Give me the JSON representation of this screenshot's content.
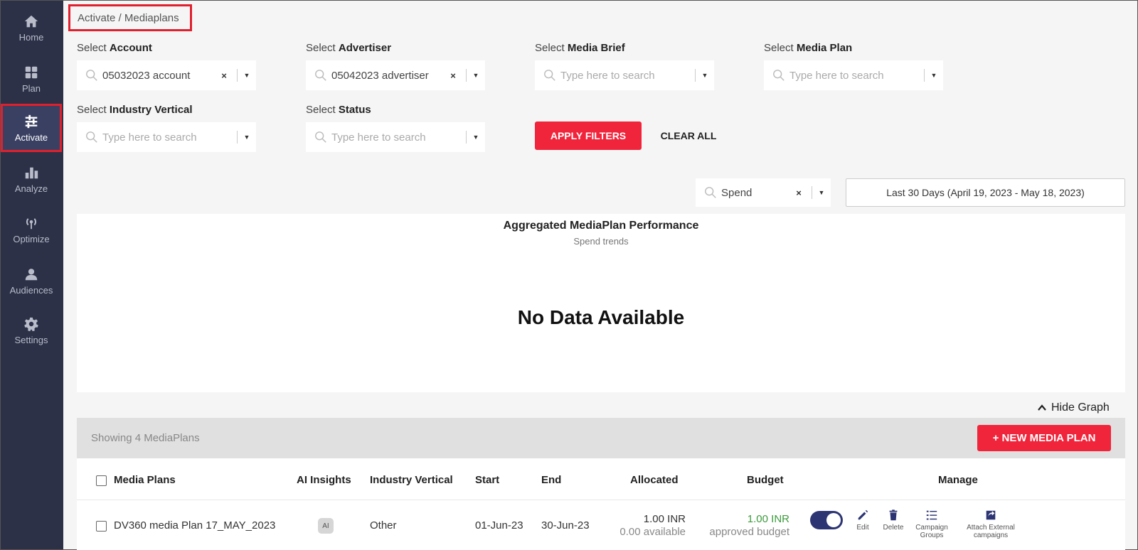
{
  "sidebar": {
    "items": [
      {
        "label": "Home",
        "icon": "home-icon"
      },
      {
        "label": "Plan",
        "icon": "grid-icon"
      },
      {
        "label": "Activate",
        "icon": "sliders-icon",
        "active": true
      },
      {
        "label": "Analyze",
        "icon": "bar-chart-icon"
      },
      {
        "label": "Optimize",
        "icon": "broadcast-icon"
      },
      {
        "label": "Audiences",
        "icon": "person-icon"
      },
      {
        "label": "Settings",
        "icon": "gear-icon"
      }
    ]
  },
  "breadcrumb": "Activate / Mediaplans",
  "filters": {
    "account": {
      "label_prefix": "Select ",
      "label_bold": "Account",
      "value": "05032023 account"
    },
    "advertiser": {
      "label_prefix": "Select ",
      "label_bold": "Advertiser",
      "value": "05042023 advertiser"
    },
    "media_brief": {
      "label_prefix": "Select ",
      "label_bold": "Media Brief",
      "placeholder": "Type here to search"
    },
    "media_plan": {
      "label_prefix": "Select ",
      "label_bold": "Media Plan",
      "placeholder": "Type here to search"
    },
    "industry_vertical": {
      "label_prefix": "Select ",
      "label_bold": "Industry Vertical",
      "placeholder": "Type here to search"
    },
    "status": {
      "label_prefix": "Select ",
      "label_bold": "Status",
      "placeholder": "Type here to search"
    },
    "apply_label": "APPLY FILTERS",
    "clear_label": "CLEAR ALL"
  },
  "metric_select": {
    "value": "Spend"
  },
  "date_range": "Last 30 Days (April 19, 2023 - May 18, 2023)",
  "chart": {
    "title": "Aggregated MediaPlan Performance",
    "subtitle": "Spend trends",
    "empty_message": "No Data Available"
  },
  "hide_graph_label": "Hide Graph",
  "table": {
    "showing": "Showing 4 MediaPlans",
    "new_button": "+ NEW MEDIA PLAN",
    "columns": [
      "Media Plans",
      "AI Insights",
      "Industry Vertical",
      "Start",
      "End",
      "Allocated",
      "Budget",
      "Manage"
    ],
    "rows": [
      {
        "name": "DV360 media Plan 17_MAY_2023",
        "ai_badge": "AI",
        "industry_vertical": "Other",
        "start": "01-Jun-23",
        "end": "30-Jun-23",
        "allocated": "1.00 INR",
        "available": "0.00 available",
        "budget": "1.00 INR",
        "budget_note": "approved budget",
        "actions": {
          "edit": "Edit",
          "delete": "Delete",
          "campaign_groups": [
            "Campaign",
            "Groups"
          ],
          "attach": [
            "Attach External",
            "campaigns"
          ]
        }
      }
    ]
  },
  "colors": {
    "sidebar_bg": "#2c3148",
    "accent_red": "#f0243a",
    "budget_green": "#3c9a3c",
    "toggle_on": "#2c3473"
  }
}
